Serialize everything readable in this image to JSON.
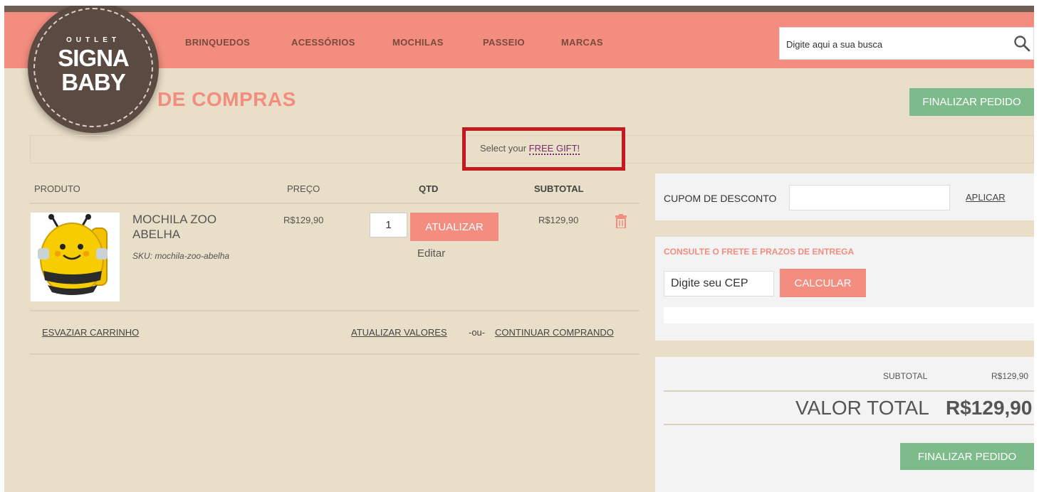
{
  "header": {
    "nav": [
      "BRINQUEDOS",
      "ACESSÓRIOS",
      "MOCHILAS",
      "PASSEIO",
      "MARCAS"
    ],
    "search_placeholder": "Digite aqui a sua busca"
  },
  "logo": {
    "line1": "OUTLET",
    "line2": "SIGNA",
    "line3": "BABY"
  },
  "page": {
    "title": "CARRINHO DE COMPRAS",
    "title_visible": "DE COMPRAS",
    "checkout_label": "FINALIZAR PEDIDO"
  },
  "gift": {
    "prefix": "Select your",
    "link": "FREE GIFT!"
  },
  "table": {
    "headers": {
      "product": "PRODUTO",
      "price": "PREÇO",
      "qty": "QTD",
      "subtotal": "SUBTOTAL"
    }
  },
  "item": {
    "name_line1": "MOCHILA ZOO",
    "name_line2": "ABELHA",
    "sku": "SKU: mochila-zoo-abelha",
    "price": "R$129,90",
    "qty": "1",
    "update_label": "ATUALIZAR",
    "edit_label": "Editar",
    "subtotal": "R$129,90"
  },
  "actions": {
    "empty_cart": "ESVAZIAR CARRINHO",
    "update_values": "ATUALIZAR VALORES",
    "or": "-ou-",
    "continue": "CONTINUAR COMPRANDO"
  },
  "coupon": {
    "label": "CUPOM DE DESCONTO",
    "apply": "APLICAR"
  },
  "shipping": {
    "title": "CONSULTE O FRETE E PRAZOS DE ENTREGA",
    "cep_placeholder": "Digite seu CEP",
    "calc_label": "CALCULAR"
  },
  "totals": {
    "subtotal_label": "SUBTOTAL",
    "subtotal_value": "R$129,90",
    "total_label": "VALOR TOTAL",
    "total_value": "R$129,90",
    "checkout_label": "FINALIZAR PEDIDO"
  },
  "colors": {
    "salmon": "#f28d7f",
    "green": "#7dbb8a",
    "beige": "#e9dec7",
    "gift_red": "#c4191e"
  }
}
